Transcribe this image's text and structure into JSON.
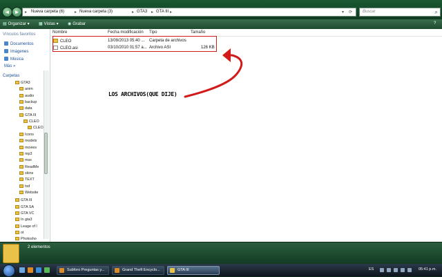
{
  "window": {
    "breadcrumbs": [
      "Nueva carpeta (6)",
      "Nueva carpeta (3)",
      "GTA3",
      "GTA III"
    ],
    "search_placeholder": "Buscar"
  },
  "toolbar": {
    "organize": "Organizar",
    "views": "Vistas",
    "burn": "Grabar"
  },
  "nav": {
    "favorites_header": "Vínculos favoritos",
    "favorites": [
      "Documentos",
      "Imágenes",
      "Música"
    ],
    "more": "Más",
    "folders_header": "Carpetas",
    "tree": [
      {
        "label": "GTA3",
        "level": 1
      },
      {
        "label": "anim",
        "level": 2
      },
      {
        "label": "audio",
        "level": 2
      },
      {
        "label": "backup",
        "level": 2
      },
      {
        "label": "data",
        "level": 2
      },
      {
        "label": "GTA III",
        "level": 2
      },
      {
        "label": "CLEO",
        "level": 3
      },
      {
        "label": "CLEO",
        "level": 4
      },
      {
        "label": "Icons",
        "level": 2
      },
      {
        "label": "models",
        "level": 2
      },
      {
        "label": "movies",
        "level": 2
      },
      {
        "label": "mp3",
        "level": 2
      },
      {
        "label": "mss",
        "level": 2
      },
      {
        "label": "ReadMe",
        "level": 2
      },
      {
        "label": "skins",
        "level": 2
      },
      {
        "label": "TEXT",
        "level": 2
      },
      {
        "label": "txd",
        "level": 2
      },
      {
        "label": "Website",
        "level": 2
      },
      {
        "label": "GTA III",
        "level": 1
      },
      {
        "label": "GTA SA",
        "level": 1
      },
      {
        "label": "GTA VC",
        "level": 1
      },
      {
        "label": "In gta3",
        "level": 1
      },
      {
        "label": "Leage of l",
        "level": 1
      },
      {
        "label": "ot",
        "level": 1
      },
      {
        "label": "Photosho",
        "level": 1
      }
    ]
  },
  "list": {
    "columns": [
      "Nombre",
      "Fecha modificación",
      "Tipo",
      "Tamaño"
    ],
    "rows": [
      {
        "name": "CLEO",
        "date": "13/09/2013 05:40 ...",
        "type": "Carpeta de archivos",
        "size": "",
        "kind": "folder"
      },
      {
        "name": "CLEO.asi",
        "date": "03/10/2010 01:57 a...",
        "type": "Archivo ASI",
        "size": "126 KB",
        "kind": "file"
      }
    ]
  },
  "annotation": "LOS ARCHIVOS(QUE DIJE)",
  "status": {
    "count": "2 elementos"
  },
  "taskbar": {
    "buttons": [
      "Subforo Preguntas y...",
      "Grand Theft Encyclo...",
      "GTA III"
    ],
    "lang": "ES",
    "clock": "05:41 p.m."
  },
  "colors": {
    "annotation_red": "#d21a1a",
    "folder": "#e9c24a",
    "chrome": "#0f3a22"
  },
  "icons": [
    "back-icon",
    "forward-icon",
    "search-icon",
    "folder-icon",
    "file-icon",
    "start-orb-icon"
  ]
}
